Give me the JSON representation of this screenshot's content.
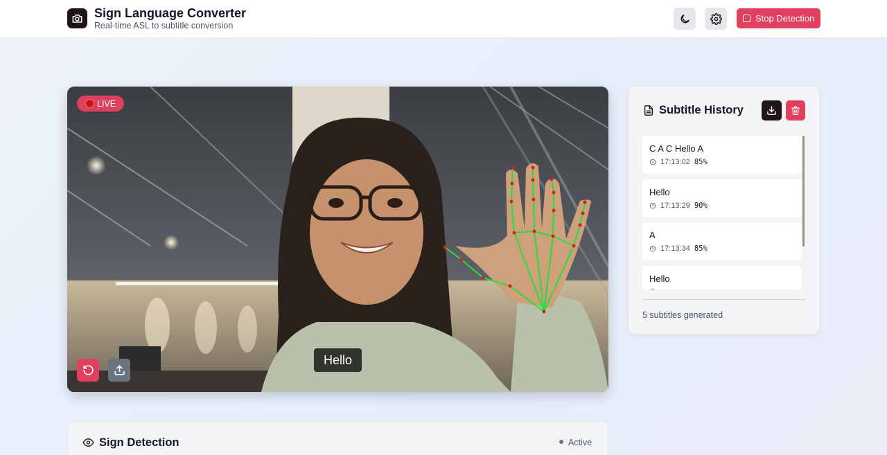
{
  "header": {
    "title": "Sign Language Converter",
    "subtitle": "Real-time ASL to subtitle conversion",
    "logo_icon": "camera-icon",
    "theme_icon": "moon-icon",
    "settings_icon": "gear-icon",
    "stop_label": "Stop Detection"
  },
  "video": {
    "live_label": "LIVE",
    "caption": "Hello",
    "reset_icon": "rotate-ccw-icon",
    "upload_icon": "upload-icon"
  },
  "history": {
    "title": "Subtitle History",
    "download_icon": "download-icon",
    "delete_icon": "trash-icon",
    "items": [
      {
        "text": "C A C Hello A",
        "time": "17:13:02",
        "confidence": "85%"
      },
      {
        "text": "Hello",
        "time": "17:13:29",
        "confidence": "90%"
      },
      {
        "text": "A",
        "time": "17:13:34",
        "confidence": "85%"
      },
      {
        "text": "Hello",
        "time": "",
        "confidence": ""
      }
    ],
    "count_text": "5 subtitles generated"
  },
  "detection": {
    "title": "Sign Detection",
    "status": "Active"
  },
  "colors": {
    "accent": "#e0405e",
    "dark": "#1f1419",
    "landmark_line": "#22e040",
    "landmark_point": "#e01c1c"
  }
}
